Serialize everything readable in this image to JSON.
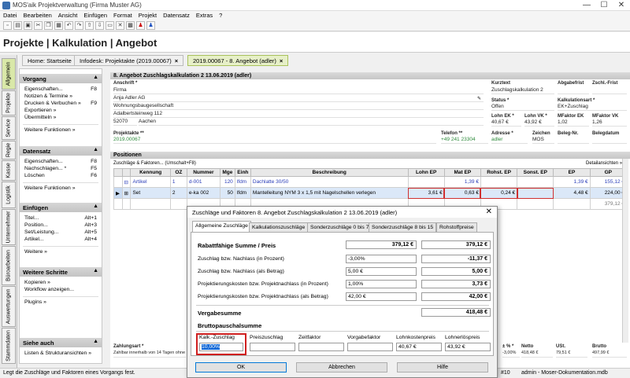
{
  "window": {
    "title": "MOS'aik Projektverwaltung (Firma Muster AG)",
    "min": "—",
    "max": "☐",
    "close": "✕"
  },
  "menu": [
    "Datei",
    "Bearbeiten",
    "Ansicht",
    "Einfügen",
    "Format",
    "Projekt",
    "Datensatz",
    "Extras",
    "?"
  ],
  "breadcrumb": "Projekte | Kalkulation | Angebot",
  "tabs": [
    {
      "label": "Home: Startseite"
    },
    {
      "label": "Infodesk: Projektakte (2019.00067)"
    },
    {
      "label": "2019.00067 - 8. Angebot (adler)"
    }
  ],
  "sidetabs": [
    "Allgemein",
    "Projekte",
    "Service",
    "Regie",
    "Kasse",
    "Logistik",
    "Unternehmer",
    "Büroarbeiten",
    "Auswertungen",
    "Stammdaten"
  ],
  "sidebar": {
    "vorgang": {
      "title": "Vorgang",
      "items": [
        {
          "label": "Eigenschaften...",
          "key": "F8"
        },
        {
          "label": "Notizen & Termine »",
          "key": ""
        },
        {
          "label": "Drucken & Verbuchen »",
          "key": "F9"
        },
        {
          "label": "Exportieren »",
          "key": ""
        },
        {
          "label": "Übermitteln »",
          "key": ""
        }
      ],
      "more": "Weitere Funktionen »"
    },
    "datensatz": {
      "title": "Datensatz",
      "items": [
        {
          "label": "Eigenschaften...",
          "key": "F8"
        },
        {
          "label": "Nachschlagen... *",
          "key": "F5"
        },
        {
          "label": "Löschen",
          "key": "F6"
        }
      ],
      "more": "Weitere Funktionen »"
    },
    "einfuegen": {
      "title": "Einfügen",
      "items": [
        {
          "label": "Titel...",
          "key": "Alt+1"
        },
        {
          "label": "Position...",
          "key": "Alt+3"
        },
        {
          "label": "Set/Leistung...",
          "key": "Alt+5"
        },
        {
          "label": "Artikel...",
          "key": "Alt+4"
        }
      ],
      "more": "Weitere »"
    },
    "schritte": {
      "title": "Weitere Schritte",
      "items": [
        {
          "label": "Kopieren »"
        },
        {
          "label": "Workflow anzeigen..."
        }
      ],
      "more": "Plugins »"
    },
    "siehe": {
      "title": "Siehe auch",
      "items": [
        {
          "label": "Listen & Strukturansichten »"
        }
      ]
    }
  },
  "doc": {
    "title": "8. Angebot Zuschlagskalkulation 2 13.06.2019 (adler)",
    "anschrift_label": "Anschrift *",
    "anschrift": [
      "Firma",
      "Anja Adler AG",
      "Wohnungsbaugesellschaft",
      "Adalbertsteinweg 112"
    ],
    "plz": "52070",
    "ort": "Aachen",
    "kurztext_label": "Kurztext",
    "kurztext": "Zuschlagskalkulation 2",
    "abgabefrist_label": "Abgabefrist",
    "zschl_label": "Zschl.-Frist",
    "status_label": "Status *",
    "status": "Offen",
    "kalkart_label": "Kalkulationsart *",
    "kalkart": "EK+Zuschlag",
    "lohnek_label": "Lohn EK *",
    "lohnek": "40,67 €",
    "lohnvk_label": "Lohn VK *",
    "lohnvk": "43,92 €",
    "mfek_label": "MFaktor EK",
    "mfek": "1,02",
    "mfvk_label": "MFaktor VK",
    "mfvk": "1,26",
    "projektakte_label": "Projektakte **",
    "projektakte": "2019.00067",
    "telefon_label": "Telefon **",
    "telefon": "+49 241 23304",
    "adresse_label": "Adresse *",
    "adresse": "adler",
    "zeichen_label": "Zeichen",
    "zeichen": "MOS",
    "belegnr_label": "Beleg-Nr.",
    "belegdatum_label": "Belegdatum"
  },
  "positions": {
    "title": "Positionen",
    "toolbar": "Zuschläge & Faktoren... (Umschalt+F8)",
    "detail": "Detailansichten »",
    "columns": [
      "Kennung",
      "OZ",
      "Nummer",
      "Mge",
      "Einh",
      "Beschreibung",
      "Lohn EP",
      "Mat EP",
      "Rohst. EP",
      "Sonst. EP",
      "EP",
      "GP"
    ],
    "rows": [
      [
        "Artikel",
        "1",
        "d-001",
        "120",
        "lfdm",
        "Dachlatte 30/50",
        "",
        "1,39 €",
        "",
        "",
        "1,39 €",
        "155,12 €"
      ],
      [
        "Set",
        "2",
        "e-ka 002",
        "50",
        "lfdm",
        "Mantelleitung NYM 3 x 1,5 mit Nagelschellen verlegen",
        "3,61 €",
        "0,63 €",
        "0,24 €",
        "",
        "4,48 €",
        "224,00 €"
      ],
      [
        "",
        "",
        "",
        "",
        "",
        "",
        "",
        "",
        "",
        "",
        "",
        "379,12 €"
      ]
    ]
  },
  "footer": {
    "zahlungsart_label": "Zahlungsart *",
    "zahlungsart": "Zahlbar innerhalb von 14 Tagen ohne",
    "pct_label": "± % *",
    "pct": "-3,00%",
    "netto_label": "Netto",
    "netto": "418,48 €",
    "ust_label": "USt.",
    "ust": "79,51 €",
    "brutto_label": "Brutto",
    "brutto": "497,99 €"
  },
  "dialog": {
    "title": "Zuschläge und Faktoren 8. Angebot Zuschlagskalkulation 2 13.06.2019 (adler)",
    "close": "✕",
    "tabs": [
      "Allgemeine Zuschläge",
      "Kalkulationszuschläge",
      "Sonderzuschläge 0 bis 7",
      "Sonderzuschläge 8 bis 15",
      "Rohstoffpreise"
    ],
    "rows": [
      {
        "label": "Rabattfähige Summe / Preis",
        "input": "379,12 €",
        "result": "379,12 €"
      },
      {
        "label": "Zuschlag bzw. Nachlass (in Prozent)",
        "input": "-3,00%",
        "result": "-11,37 €"
      },
      {
        "label": "Zuschlag bzw. Nachlass (als Betrag)",
        "input": "5,00 €",
        "result": "5,00 €"
      },
      {
        "label": "Projektierungskosten bzw. Projektnachlass (in Prozent)",
        "input": "1,00%",
        "result": "3,73 €"
      },
      {
        "label": "Projektierungskosten bzw. Projektnachlass (als Betrag)",
        "input": "42,00 €",
        "result": "42,00 €"
      }
    ],
    "vergabe_label": "Vergabesumme",
    "vergabe": "418,48 €",
    "brutto_label": "Bruttopauschalsumme",
    "fields": [
      {
        "label": "Kalk.-Zuschlag",
        "value": "10,00%"
      },
      {
        "label": "Preiszuschlag",
        "value": ""
      },
      {
        "label": "Zeitfaktor",
        "value": ""
      },
      {
        "label": "Vorgabefaktor",
        "value": ""
      },
      {
        "label": "Lohnkostenpreis",
        "value": "40,67 €"
      },
      {
        "label": "Lohnerlöspreis",
        "value": "43,92 €"
      }
    ],
    "ok": "OK",
    "cancel": "Abbrechen",
    "help": "Hilfe"
  },
  "status": {
    "text": "Legt die Zuschläge und Faktoren eines Vorgangs fest.",
    "rec": "#10",
    "db": "admin - Moser-Dokumentation.mdb"
  }
}
